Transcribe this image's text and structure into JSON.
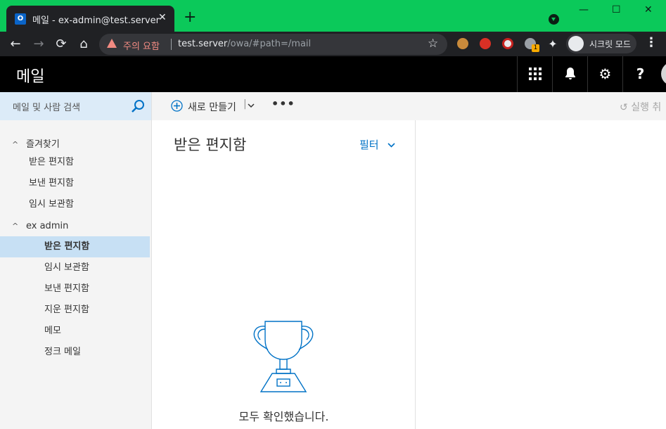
{
  "browser": {
    "tab_title": "메일 - ex-admin@test.server",
    "tab_favicon": "O",
    "tab_close": "✕",
    "new_tab": "+",
    "security_warning": "주의 요함",
    "url_host": "test.server",
    "url_path": "/owa/#path=/mail",
    "incognito_label": "시크릿 모드",
    "extension_badge": "1",
    "window_controls": {
      "minimize": "—",
      "maximize": "☐",
      "close": "✕"
    }
  },
  "header": {
    "title": "메일",
    "buttons": [
      {
        "icon": "app-launcher-icon"
      },
      {
        "icon": "bell-icon"
      },
      {
        "icon": "gear-icon"
      },
      {
        "icon": "help-icon",
        "label": "?"
      }
    ]
  },
  "search": {
    "placeholder": "메일 및 사람 검색"
  },
  "sidebar": {
    "favorites": {
      "label": "즐겨찾기",
      "items": [
        "받은 편지함",
        "보낸 편지함",
        "임시 보관함"
      ]
    },
    "account": {
      "label": "ex admin",
      "items": [
        "받은 편지함",
        "임시 보관함",
        "보낸 편지함",
        "지운 편지함",
        "메모",
        "정크 메일"
      ],
      "selected_index": 0
    }
  },
  "command_bar": {
    "new_label": "새로 만들기",
    "undo_label": "실행 취"
  },
  "message_list": {
    "title": "받은 편지함",
    "filter_label": "필터",
    "empty_message": "모두 확인했습니다."
  },
  "colors": {
    "chrome_frame": "#0bc95a",
    "accent": "#0072c6",
    "selected_folder": "#c7e0f4",
    "search_bg": "#dcebf8",
    "header_bg": "#000000"
  }
}
